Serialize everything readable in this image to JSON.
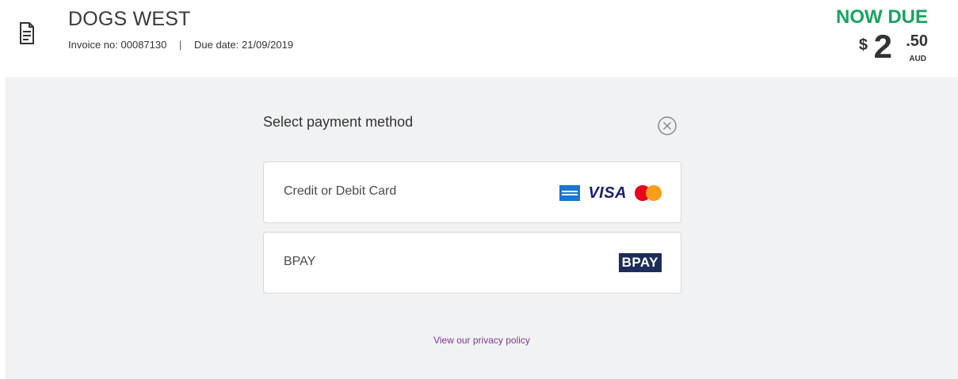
{
  "header": {
    "merchant_name": "DOGS WEST",
    "invoice_label": "Invoice no:",
    "invoice_number": "00087130",
    "separator": "|",
    "due_date_label": "Due date:",
    "due_date": "21/09/2019",
    "document_icon": "document-icon"
  },
  "amount_due": {
    "label": "NOW DUE",
    "currency_symbol": "$",
    "whole": "2",
    "cents": ".50",
    "currency_code": "AUD",
    "color": "#1aa360"
  },
  "payment": {
    "title": "Select payment method",
    "close_icon": "close-circle-icon",
    "options": [
      {
        "label": "Credit or Debit Card",
        "logos": [
          "amex-logo",
          "VISA",
          "mastercard-logo"
        ]
      },
      {
        "label": "BPAY",
        "logo": "BPAY"
      }
    ]
  },
  "footer": {
    "privacy_link": "View our privacy policy"
  }
}
